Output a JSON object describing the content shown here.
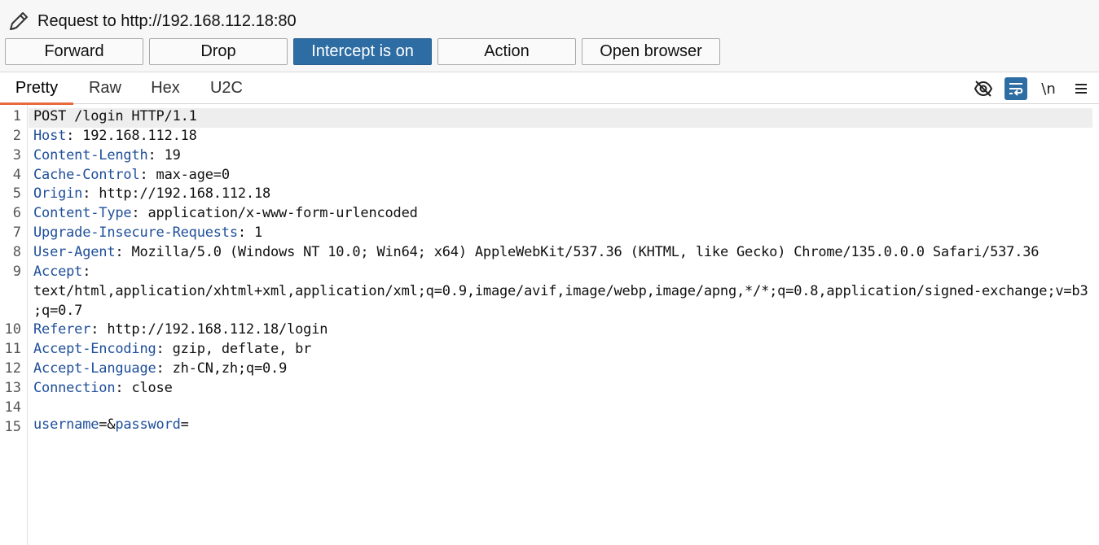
{
  "header": {
    "title": "Request to http://192.168.112.18:80",
    "edit_icon": "pencil-icon"
  },
  "toolbar": {
    "forward_label": "Forward",
    "drop_label": "Drop",
    "intercept_label": "Intercept is on",
    "action_label": "Action",
    "open_browser_label": "Open browser"
  },
  "tabs": {
    "pretty": "Pretty",
    "raw": "Raw",
    "hex": "Hex",
    "u2c": "U2C"
  },
  "tools": {
    "hide_icon": "eye-slash-icon",
    "wrap_icon": "word-wrap-icon",
    "newline_label": "\\n",
    "menu_icon": "hamburger-menu-icon"
  },
  "colors": {
    "accent": "#2e6da4",
    "tab_underline": "#e8693c",
    "header_name": "#1f4f9a"
  },
  "request": {
    "lines": [
      {
        "num": "1",
        "key": "",
        "sep": "",
        "value": "POST /login HTTP/1.1"
      },
      {
        "num": "2",
        "key": "Host",
        "sep": ": ",
        "value": "192.168.112.18"
      },
      {
        "num": "3",
        "key": "Content-Length",
        "sep": ": ",
        "value": "19"
      },
      {
        "num": "4",
        "key": "Cache-Control",
        "sep": ": ",
        "value": "max-age=0"
      },
      {
        "num": "5",
        "key": "Origin",
        "sep": ": ",
        "value": "http://192.168.112.18"
      },
      {
        "num": "6",
        "key": "Content-Type",
        "sep": ": ",
        "value": "application/x-www-form-urlencoded"
      },
      {
        "num": "7",
        "key": "Upgrade-Insecure-Requests",
        "sep": ": ",
        "value": "1"
      },
      {
        "num": "8",
        "key": "User-Agent",
        "sep": ": ",
        "value": "Mozilla/5.0 (Windows NT 10.0; Win64; x64) AppleWebKit/537.36 (KHTML, like Gecko) Chrome/135.0.0.0 Safari/537.36"
      },
      {
        "num": "9",
        "key": "Accept",
        "sep": ":",
        "value": ""
      },
      {
        "num": "",
        "key": "",
        "sep": "",
        "value": "text/html,application/xhtml+xml,application/xml;q=0.9,image/avif,image/webp,image/apng,*/*;q=0.8,application/signed-exchange;v=b3"
      },
      {
        "num": "",
        "key": "",
        "sep": "",
        "value": ";q=0.7"
      },
      {
        "num": "10",
        "key": "Referer",
        "sep": ": ",
        "value": "http://192.168.112.18/login"
      },
      {
        "num": "11",
        "key": "Accept-Encoding",
        "sep": ": ",
        "value": "gzip, deflate, br"
      },
      {
        "num": "12",
        "key": "Accept-Language",
        "sep": ": ",
        "value": "zh-CN,zh;q=0.9"
      },
      {
        "num": "13",
        "key": "Connection",
        "sep": ": ",
        "value": "close"
      },
      {
        "num": "14",
        "key": "",
        "sep": "",
        "value": ""
      },
      {
        "num": "15",
        "key": "",
        "sep": "",
        "value": ""
      }
    ],
    "body": {
      "param1": "username",
      "eq1": "=&",
      "param2": "password",
      "eq2": "="
    }
  }
}
